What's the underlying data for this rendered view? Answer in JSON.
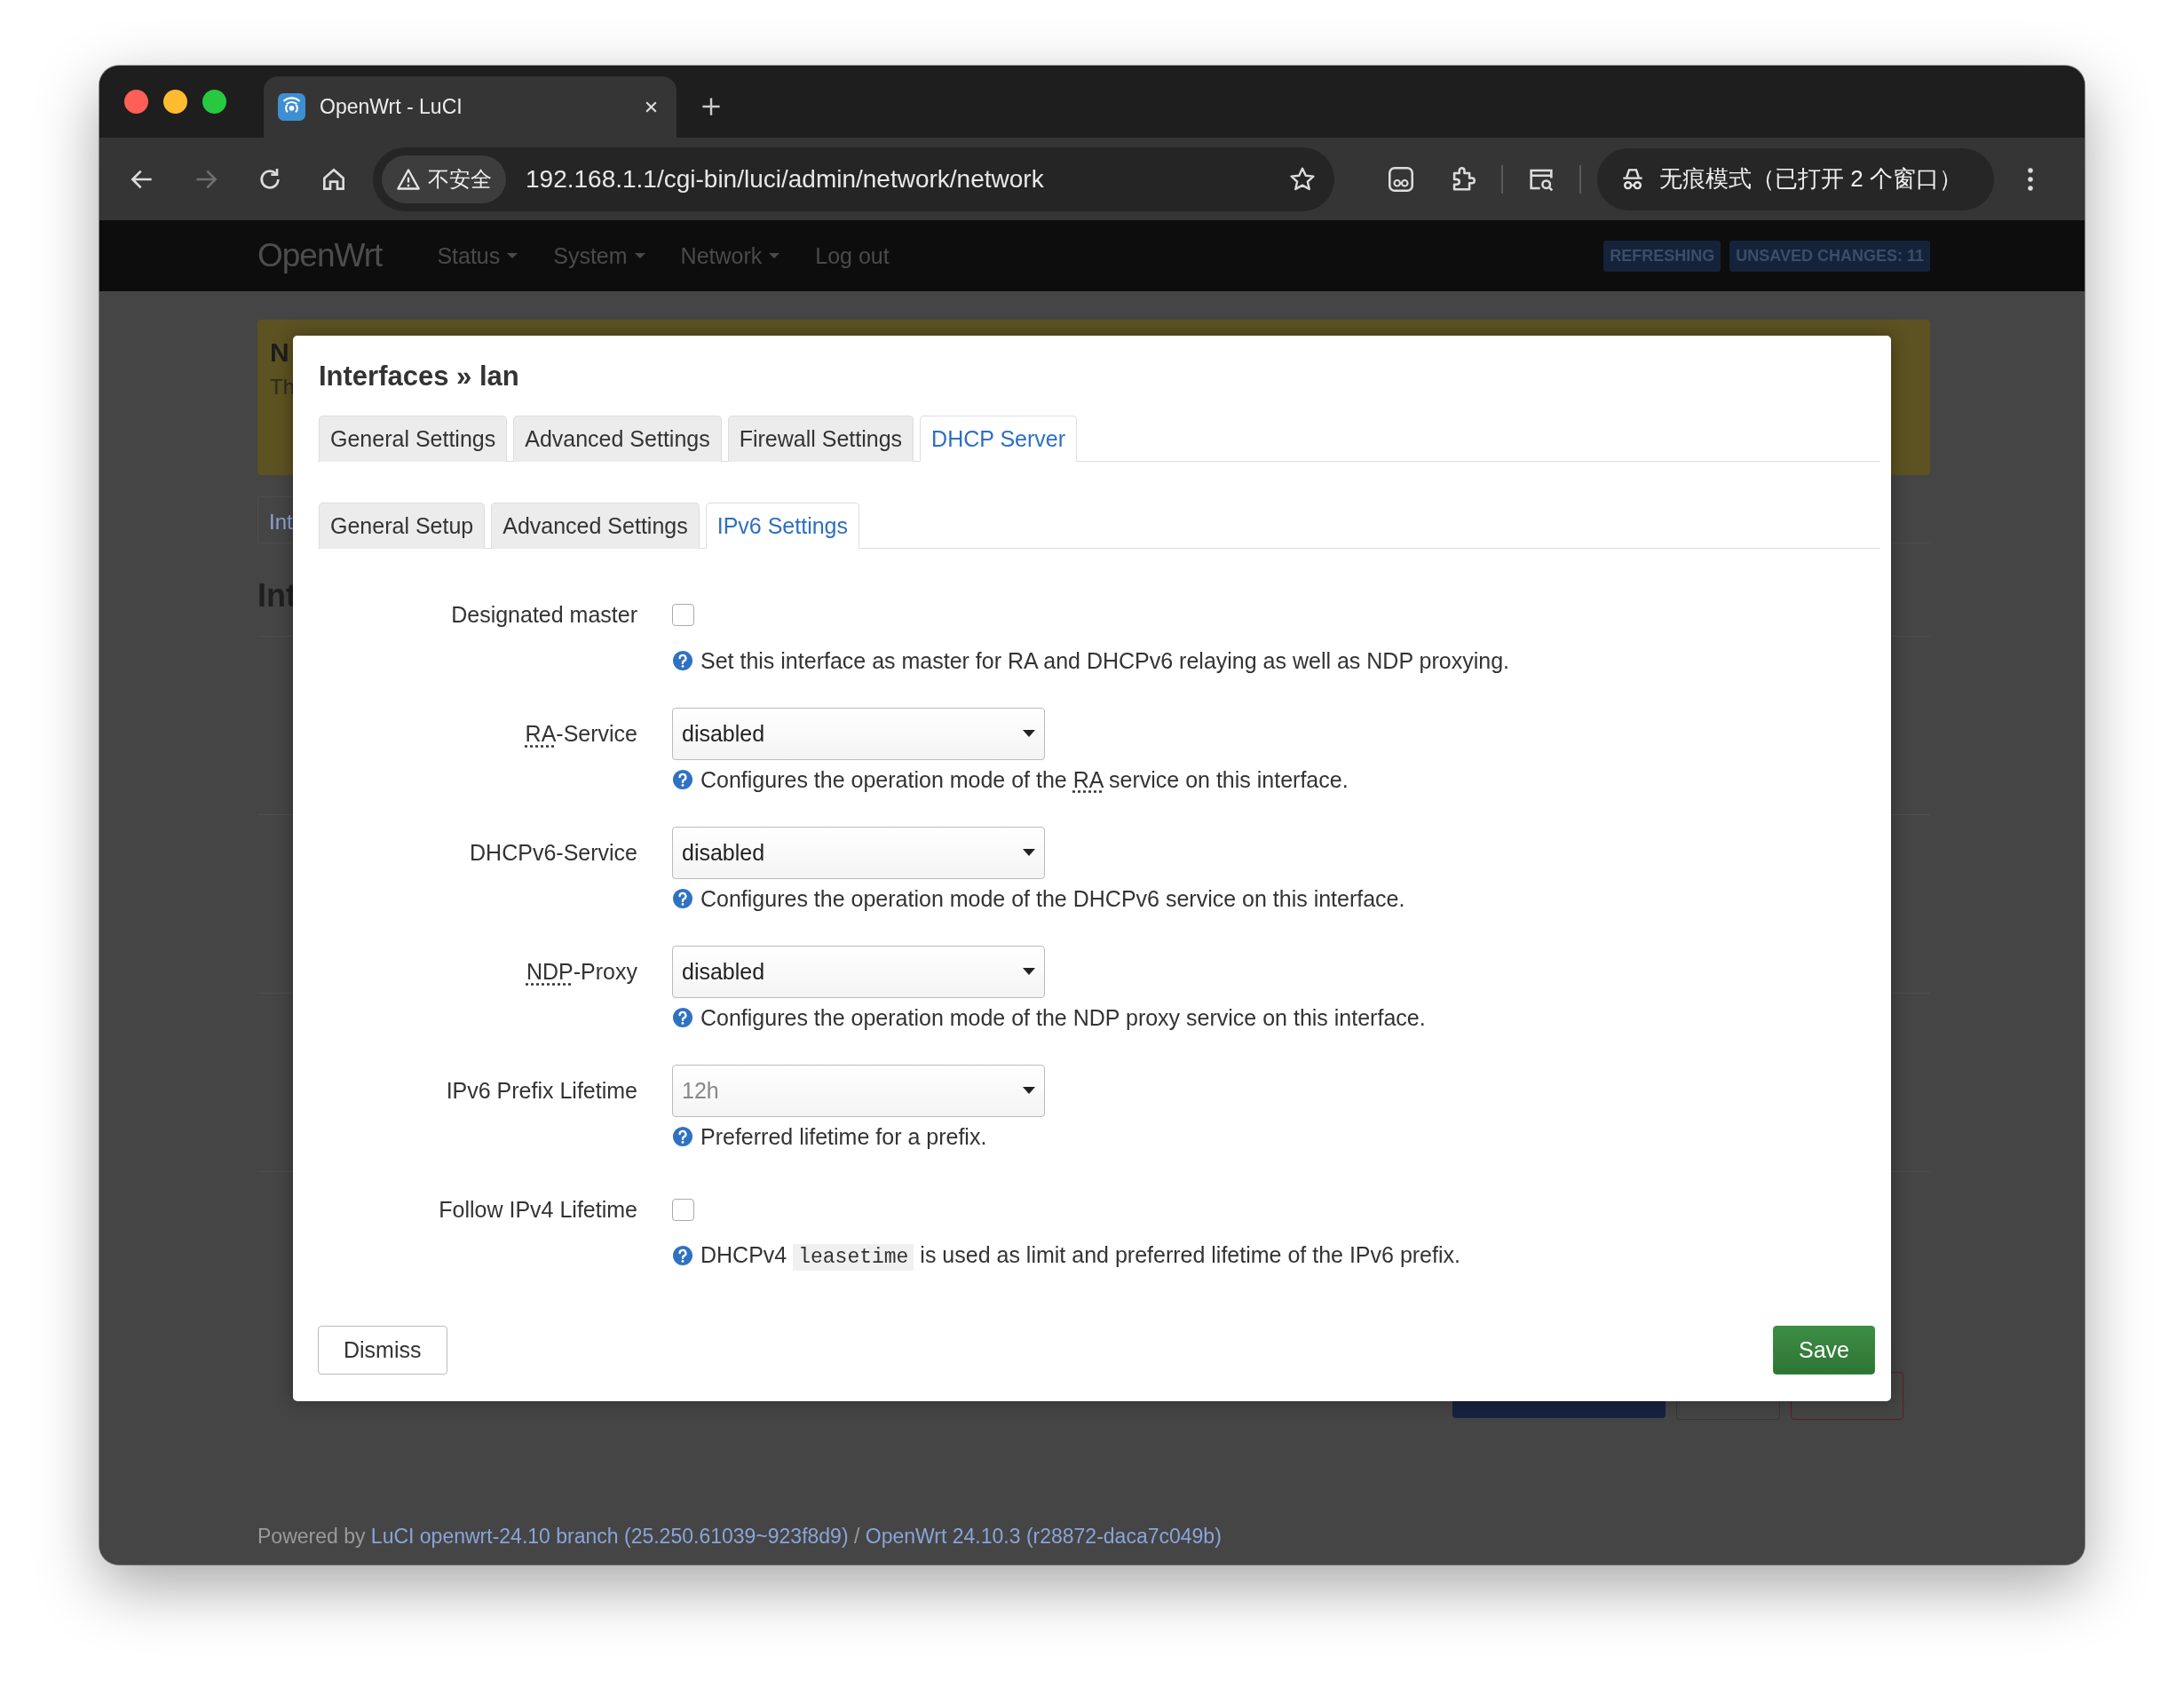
{
  "browser": {
    "tabs": [
      {
        "title": "OpenWrt - LuCI",
        "selected": true
      }
    ],
    "nav_buttons": [
      {
        "kind": "back",
        "disabled": false
      },
      {
        "kind": "forward",
        "disabled": true
      },
      {
        "kind": "reload",
        "disabled": false
      },
      {
        "kind": "home",
        "disabled": false
      }
    ],
    "address": {
      "security_label": "不安全",
      "url": "192.168.1.1/cgi-bin/luci/admin/network/network"
    },
    "profile_chip": "无痕模式（已打开 2 个窗口）"
  },
  "header": {
    "brand": "OpenWrt",
    "menu": [
      {
        "label": "Status",
        "dropdown": true
      },
      {
        "label": "System",
        "dropdown": true
      },
      {
        "label": "Network",
        "dropdown": true
      },
      {
        "label": "Log out",
        "dropdown": false
      }
    ],
    "badges": [
      "REFRESHING",
      "UNSAVED CHANGES: 11"
    ]
  },
  "background_page": {
    "notice": {
      "title": "N",
      "text": "Th"
    },
    "tab": "Int",
    "heading": "Int",
    "footer": [
      {
        "kind": "text",
        "text": "Powered by "
      },
      {
        "kind": "link",
        "text": "LuCI openwrt-24.10 branch (25.250.61039~923f8d9)"
      },
      {
        "kind": "text",
        "text": " / "
      },
      {
        "kind": "link",
        "text": "OpenWrt 24.10.3 (r28872-daca7c049b)"
      }
    ]
  },
  "dialog": {
    "title": "Interfaces » lan",
    "tabs": [
      {
        "label": "General Settings",
        "selected": false
      },
      {
        "label": "Advanced Settings",
        "selected": false
      },
      {
        "label": "Firewall Settings",
        "selected": false
      },
      {
        "label": "DHCP Server",
        "selected": true
      }
    ],
    "subtabs": [
      {
        "label": "General Setup",
        "selected": false
      },
      {
        "label": "Advanced Settings",
        "selected": false
      },
      {
        "label": "IPv6 Settings",
        "selected": true
      }
    ],
    "fields": [
      {
        "kind": "checkbox",
        "label": [
          {
            "kind": "text",
            "text": "Designated master"
          }
        ],
        "checked": false,
        "help": [
          {
            "kind": "text",
            "text": "Set this interface as master for RA and DHCPv6 relaying as well as NDP proxying."
          }
        ]
      },
      {
        "kind": "select",
        "label": [
          {
            "kind": "abbr",
            "text": "RA"
          },
          {
            "kind": "text",
            "text": "-Service"
          }
        ],
        "value": "disabled",
        "help": [
          {
            "kind": "text",
            "text": "Configures the operation mode of the "
          },
          {
            "kind": "abbr",
            "text": "RA"
          },
          {
            "kind": "text",
            "text": " service on this interface."
          }
        ]
      },
      {
        "kind": "select",
        "label": [
          {
            "kind": "text",
            "text": "DHCPv6-Service"
          }
        ],
        "value": "disabled",
        "help": [
          {
            "kind": "text",
            "text": "Configures the operation mode of the DHCPv6 service on this interface."
          }
        ]
      },
      {
        "kind": "select",
        "label": [
          {
            "kind": "abbr",
            "text": "NDP"
          },
          {
            "kind": "text",
            "text": "-Proxy"
          }
        ],
        "value": "disabled",
        "help": [
          {
            "kind": "text",
            "text": "Configures the operation mode of the NDP proxy service on this interface."
          }
        ]
      },
      {
        "kind": "select",
        "label": [
          {
            "kind": "text",
            "text": "IPv6 Prefix Lifetime"
          }
        ],
        "placeholder": "12h",
        "help": [
          {
            "kind": "text",
            "text": "Preferred lifetime for a prefix."
          }
        ]
      },
      {
        "kind": "checkbox",
        "label": [
          {
            "kind": "text",
            "text": "Follow IPv4 Lifetime"
          }
        ],
        "checked": false,
        "help": [
          {
            "kind": "text",
            "text": "DHCPv4 "
          },
          {
            "kind": "code",
            "text": "leasetime"
          },
          {
            "kind": "text",
            "text": " is used as limit and preferred lifetime of the IPv6 prefix."
          }
        ]
      }
    ],
    "buttons": [
      {
        "label": "Dismiss",
        "kind": "neutral"
      },
      {
        "label": "Save",
        "kind": "positive"
      }
    ]
  }
}
